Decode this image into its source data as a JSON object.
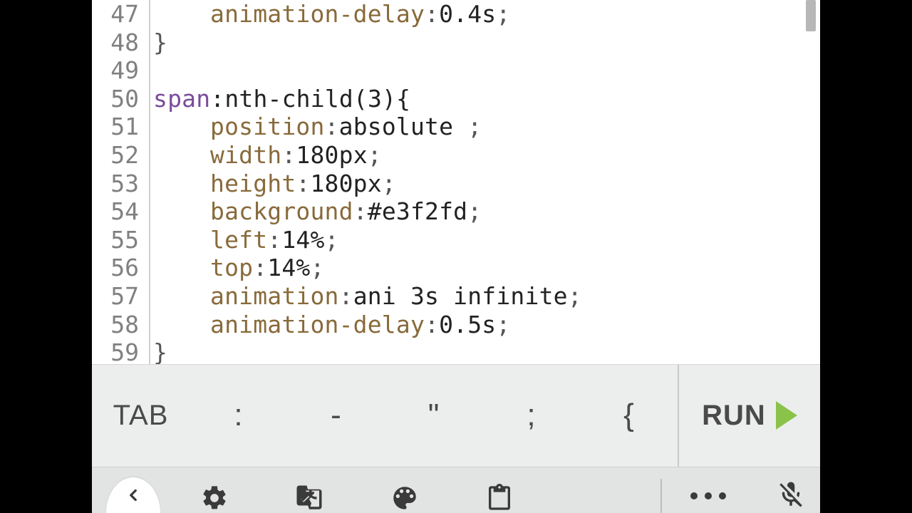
{
  "editor": {
    "lines": [
      {
        "num": 47,
        "indent": 1,
        "parts": [
          [
            "prop",
            "animation-delay"
          ],
          [
            "punct",
            ":"
          ],
          [
            "val",
            "0.4s"
          ],
          [
            "punct",
            ";"
          ]
        ]
      },
      {
        "num": 48,
        "indent": 0,
        "parts": [
          [
            "punct",
            "}"
          ]
        ]
      },
      {
        "num": 49,
        "indent": 0,
        "parts": []
      },
      {
        "num": 50,
        "indent": 0,
        "parts": [
          [
            "sel",
            "span"
          ],
          [
            "psel",
            ":nth-child(3){"
          ]
        ]
      },
      {
        "num": 51,
        "indent": 1,
        "parts": [
          [
            "prop",
            "position"
          ],
          [
            "punct",
            ":"
          ],
          [
            "val",
            "absolute "
          ],
          [
            "punct",
            ";"
          ]
        ]
      },
      {
        "num": 52,
        "indent": 1,
        "parts": [
          [
            "prop",
            "width"
          ],
          [
            "punct",
            ":"
          ],
          [
            "val",
            "180px"
          ],
          [
            "punct",
            ";"
          ]
        ]
      },
      {
        "num": 53,
        "indent": 1,
        "parts": [
          [
            "prop",
            "height"
          ],
          [
            "punct",
            ":"
          ],
          [
            "val",
            "180px"
          ],
          [
            "punct",
            ";"
          ]
        ]
      },
      {
        "num": 54,
        "indent": 1,
        "parts": [
          [
            "prop",
            "background"
          ],
          [
            "punct",
            ":"
          ],
          [
            "val",
            "#e3f2fd"
          ],
          [
            "punct",
            ";"
          ]
        ]
      },
      {
        "num": 55,
        "indent": 1,
        "parts": [
          [
            "prop",
            "left"
          ],
          [
            "punct",
            ":"
          ],
          [
            "val",
            "14%"
          ],
          [
            "punct",
            ";"
          ]
        ]
      },
      {
        "num": 56,
        "indent": 1,
        "parts": [
          [
            "prop",
            "top"
          ],
          [
            "punct",
            ":"
          ],
          [
            "val",
            "14%"
          ],
          [
            "punct",
            ";"
          ]
        ]
      },
      {
        "num": 57,
        "indent": 1,
        "parts": [
          [
            "prop",
            "animation"
          ],
          [
            "punct",
            ":"
          ],
          [
            "val",
            "ani 3s infinite"
          ],
          [
            "punct",
            ";"
          ]
        ]
      },
      {
        "num": 58,
        "indent": 1,
        "parts": [
          [
            "prop",
            "animation-delay"
          ],
          [
            "punct",
            ":"
          ],
          [
            "val",
            "0.5s"
          ],
          [
            "punct",
            ";"
          ]
        ]
      },
      {
        "num": 59,
        "indent": 0,
        "parts": [
          [
            "punct",
            "}"
          ]
        ]
      }
    ]
  },
  "keyrow": {
    "keys": [
      "TAB",
      ":",
      "-",
      "\"",
      ";",
      "{"
    ],
    "run_label": "RUN"
  },
  "navbar": {
    "icons": [
      "back",
      "settings",
      "translate",
      "palette",
      "clipboard",
      "more",
      "mic-off"
    ]
  }
}
